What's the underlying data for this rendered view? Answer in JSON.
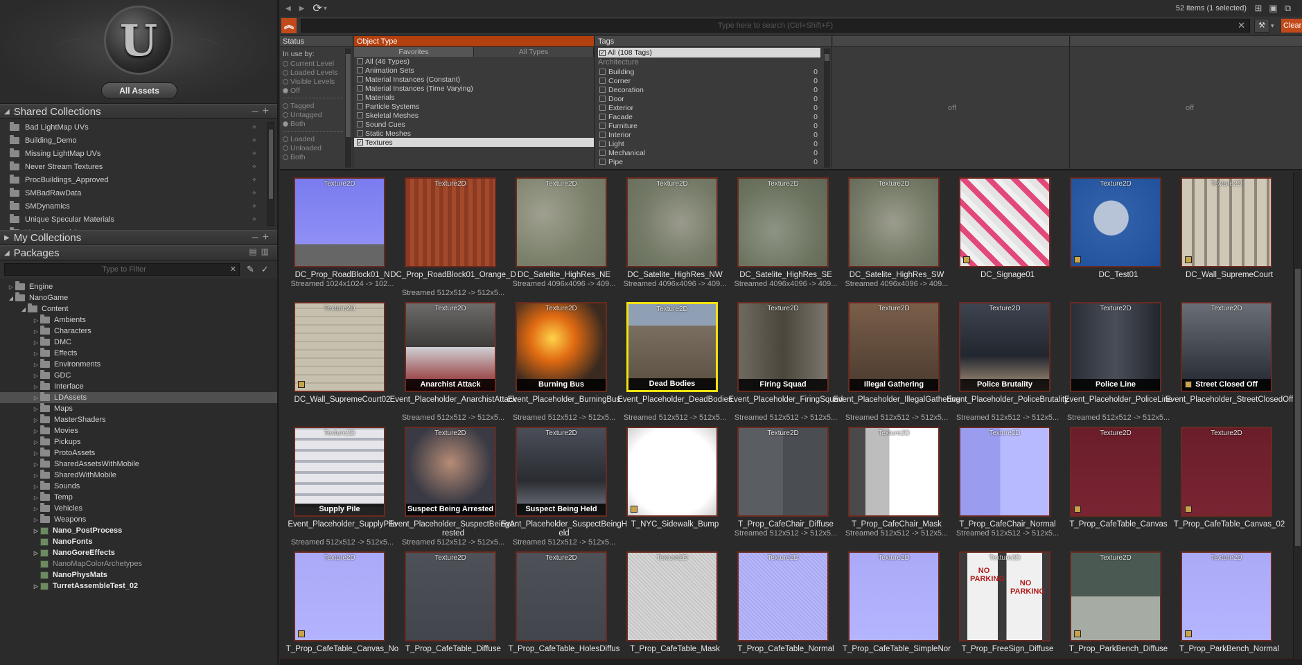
{
  "left": {
    "all_assets_label": "All Assets",
    "shared_collections": {
      "title": "Shared Collections",
      "items": [
        "Bad LightMap UVs",
        "Building_Demo",
        "Missing LightMap UVs",
        "Never Stream Textures",
        "ProcBuildings_Approved",
        "SMBadRawData",
        "SMDynamics",
        "Unique Specular Materials",
        "Unreferenced Assets"
      ]
    },
    "my_collections_title": "My Collections",
    "packages": {
      "title": "Packages",
      "filter_placeholder": "Type to Filter",
      "tree": [
        {
          "label": "Engine",
          "depth": 0,
          "kind": "folder",
          "exp": "▷"
        },
        {
          "label": "NanoGame",
          "depth": 0,
          "kind": "folder",
          "exp": "◢"
        },
        {
          "label": "Content",
          "depth": 1,
          "kind": "folder",
          "exp": "◢"
        },
        {
          "label": "Ambients",
          "depth": 2,
          "kind": "folder",
          "exp": "▷"
        },
        {
          "label": "Characters",
          "depth": 2,
          "kind": "folder",
          "exp": "▷"
        },
        {
          "label": "DMC",
          "depth": 2,
          "kind": "folder",
          "exp": "▷"
        },
        {
          "label": "Effects",
          "depth": 2,
          "kind": "folder",
          "exp": "▷"
        },
        {
          "label": "Environments",
          "depth": 2,
          "kind": "folder",
          "exp": "▷"
        },
        {
          "label": "GDC",
          "depth": 2,
          "kind": "folder",
          "exp": "▷"
        },
        {
          "label": "Interface",
          "depth": 2,
          "kind": "folder",
          "exp": "▷"
        },
        {
          "label": "LDAssets",
          "depth": 2,
          "kind": "folder",
          "exp": "▷",
          "selected": true
        },
        {
          "label": "Maps",
          "depth": 2,
          "kind": "folder",
          "exp": "▷"
        },
        {
          "label": "MasterShaders",
          "depth": 2,
          "kind": "folder",
          "exp": "▷"
        },
        {
          "label": "Movies",
          "depth": 2,
          "kind": "folder",
          "exp": "▷"
        },
        {
          "label": "Pickups",
          "depth": 2,
          "kind": "folder",
          "exp": "▷"
        },
        {
          "label": "ProtoAssets",
          "depth": 2,
          "kind": "folder",
          "exp": "▷"
        },
        {
          "label": "SharedAssetsWithMobile",
          "depth": 2,
          "kind": "folder",
          "exp": "▷"
        },
        {
          "label": "SharedWithMobile",
          "depth": 2,
          "kind": "folder",
          "exp": "▷"
        },
        {
          "label": "Sounds",
          "depth": 2,
          "kind": "folder",
          "exp": "▷"
        },
        {
          "label": "Temp",
          "depth": 2,
          "kind": "folder",
          "exp": "▷"
        },
        {
          "label": "Vehicles",
          "depth": 2,
          "kind": "folder",
          "exp": "▷"
        },
        {
          "label": "Weapons",
          "depth": 2,
          "kind": "folder",
          "exp": "▷"
        },
        {
          "label": "Nano_PostProcess",
          "depth": 2,
          "kind": "pkg",
          "exp": "▷",
          "bold": true
        },
        {
          "label": "NanoFonts",
          "depth": 2,
          "kind": "pkg",
          "exp": "",
          "bold": true
        },
        {
          "label": "NanoGoreEffects",
          "depth": 2,
          "kind": "pkg",
          "exp": "▷",
          "bold": true
        },
        {
          "label": "NanoMapColorArchetypes",
          "depth": 2,
          "kind": "pkg",
          "exp": "",
          "dim": true
        },
        {
          "label": "NanoPhysMats",
          "depth": 2,
          "kind": "pkg",
          "exp": "",
          "bold": true
        },
        {
          "label": "TurretAssembleTest_02",
          "depth": 2,
          "kind": "pkg",
          "exp": "▷",
          "bold": true
        }
      ]
    }
  },
  "topbar": {
    "count_text": "52 items (1 selected)",
    "search_placeholder": "Type here to search  (Ctrl+Shift+F)",
    "clear_label": "Clear"
  },
  "filters": {
    "status": {
      "title": "Status",
      "in_use_label": "In use by:",
      "group1": [
        {
          "label": "Current Level",
          "on": false
        },
        {
          "label": "Loaded Levels",
          "on": false
        },
        {
          "label": "Visible Levels",
          "on": false
        },
        {
          "label": "Off",
          "on": true
        }
      ],
      "group2": [
        {
          "label": "Tagged",
          "on": false
        },
        {
          "label": "Untagged",
          "on": false
        },
        {
          "label": "Both",
          "on": true
        }
      ],
      "group3": [
        {
          "label": "Loaded",
          "on": false
        },
        {
          "label": "Unloaded",
          "on": false
        },
        {
          "label": "Both",
          "on": false
        }
      ]
    },
    "object_type": {
      "title": "Object Type",
      "tab_favorites": "Favorites",
      "tab_all": "All Types",
      "items": [
        {
          "label": "All (46 Types)",
          "checked": false
        },
        {
          "label": "Animation Sets",
          "checked": false
        },
        {
          "label": "Material Instances (Constant)",
          "checked": false
        },
        {
          "label": "Material Instances (Time Varying)",
          "checked": false
        },
        {
          "label": "Materials",
          "checked": false
        },
        {
          "label": "Particle Systems",
          "checked": false
        },
        {
          "label": "Skeletal Meshes",
          "checked": false
        },
        {
          "label": "Sound Cues",
          "checked": false
        },
        {
          "label": "Static Meshes",
          "checked": false
        },
        {
          "label": "Textures",
          "checked": true
        }
      ]
    },
    "tags": {
      "title": "Tags",
      "all_label": "All (108 Tags)",
      "category": "Architecture",
      "items": [
        {
          "label": "Building",
          "count": "0"
        },
        {
          "label": "Corner",
          "count": "0"
        },
        {
          "label": "Decoration",
          "count": "0"
        },
        {
          "label": "Door",
          "count": "0"
        },
        {
          "label": "Exterior",
          "count": "0"
        },
        {
          "label": "Facade",
          "count": "0"
        },
        {
          "label": "Furniture",
          "count": "0"
        },
        {
          "label": "Interior",
          "count": "0"
        },
        {
          "label": "Light",
          "count": "0"
        },
        {
          "label": "Mechanical",
          "count": "0"
        },
        {
          "label": "Pipe",
          "count": "0"
        }
      ]
    },
    "off_label": "off"
  },
  "assets": [
    {
      "name": "DC_Prop_RoadBlock01_N",
      "info": "Streamed 1024x1024 -> 102...",
      "type": "Texture2D",
      "bg": "linear-gradient(#7a7cf0,#8f8ff5 75%,#666 75%)",
      "corner": false
    },
    {
      "name": "DC_Prop_RoadBlock01_Orange_D",
      "info": "Streamed 512x512 -> 512x5...",
      "type": "Texture2D",
      "bg": "repeating-linear-gradient(90deg,#8c3a22 0 6px,#a34a2c 6px 12px)",
      "corner": false
    },
    {
      "name": "DC_Satelite_HighRes_NE",
      "info": "Streamed 4096x4096 -> 409...",
      "type": "Texture2D",
      "bg": "radial-gradient(circle at 30% 40%,#a0a090,#7a806a 60%,#6f7462)",
      "corner": false
    },
    {
      "name": "DC_Satelite_HighRes_NW",
      "info": "Streamed 4096x4096 -> 409...",
      "type": "Texture2D",
      "bg": "radial-gradient(circle at 60% 50%,#9a9a8c,#737a66 60%,#6a6f5f)",
      "corner": false
    },
    {
      "name": "DC_Satelite_HighRes_SE",
      "info": "Streamed 4096x4096 -> 409...",
      "type": "Texture2D",
      "bg": "radial-gradient(circle at 40% 60%,#8e9484,#6c7460 60%,#5f6655)",
      "corner": false
    },
    {
      "name": "DC_Satelite_HighRes_SW",
      "info": "Streamed 4096x4096 -> 409...",
      "type": "Texture2D",
      "bg": "radial-gradient(circle at 50% 50%,#9c9c8e,#767c68 60%,#666b5a)",
      "corner": false
    },
    {
      "name": "DC_Signage01",
      "info": "",
      "type": "",
      "bg": "repeating-linear-gradient(45deg,#e4e4e4 0 10px,#e2487a 10px 18px,#f0f0f0 18px 26px)",
      "corner": true
    },
    {
      "name": "DC_Test01",
      "info": "",
      "type": "Texture2D",
      "bg": "radial-gradient(circle at 45% 45%,#b7c4d8 0 25%,#2f5fa8 26%,#1e4f9a)",
      "corner": true
    },
    {
      "name": "DC_Wall_SupremeCourt",
      "info": "",
      "type": "Texture2D",
      "bg": "repeating-linear-gradient(90deg,#cfc8b6 0 14px,#8e877a 14px 18px)",
      "corner": true
    },
    {
      "name": "DC_Wall_SupremeCourt02",
      "info": "",
      "type": "Texture2D",
      "bg": "repeating-linear-gradient(0deg,#c7c0ae 0 10px,#b4ad9b 10px 12px)",
      "corner": true
    },
    {
      "name": "Event_Placeholder_AnarchistAttack",
      "info": "Streamed 512x512 -> 512x5...",
      "type": "Texture2D",
      "bg": "linear-gradient(#6d6a6a,#3d3a3a 50%,#cfcfd4 50%,#8a1a1a)",
      "caption": "Anarchist Attack",
      "corner": false
    },
    {
      "name": "Event_Placeholder_BurningBus",
      "info": "Streamed 512x512 -> 512x5...",
      "type": "Texture2D",
      "bg": "radial-gradient(circle at 40% 40%,#ffd24a,#e06a12 30%,#3a2a20 70%)",
      "caption": "Burning Bus",
      "corner": false
    },
    {
      "name": "Event_Placeholder_DeadBodies",
      "info": "Streamed 512x512 -> 512x5...",
      "type": "Texture2D",
      "bg": "linear-gradient(#8fa0b4 0 25%,#7a6e60 25%,#5a4e40)",
      "caption": "Dead Bodies",
      "selected": true,
      "corner": false
    },
    {
      "name": "Event_Placeholder_FiringSquad",
      "info": "Streamed 512x512 -> 512x5...",
      "type": "Texture2D",
      "bg": "linear-gradient(90deg,#6e6a60,#4a463c,#7a766c)",
      "caption": "Firing Squad",
      "corner": false
    },
    {
      "name": "Event_Placeholder_IllegalGathering",
      "info": "Streamed 512x512 -> 512x5...",
      "type": "Texture2D",
      "bg": "linear-gradient(#7a5e4a,#4a3a2e)",
      "caption": "Illegal Gathering",
      "corner": false
    },
    {
      "name": "Event_Placeholder_PoliceBrutality",
      "info": "Streamed 512x512 -> 512x5...",
      "type": "Texture2D",
      "bg": "linear-gradient(#3e4450,#22262e 60%,#b09a80)",
      "caption": "Police Brutality",
      "corner": false
    },
    {
      "name": "Event_Placeholder_PoliceLine",
      "info": "Streamed 512x512 -> 512x5...",
      "type": "Texture2D",
      "bg": "linear-gradient(90deg,#2a2e36,#4a4e58,#22262c)",
      "caption": "Police Line",
      "corner": false
    },
    {
      "name": "Event_Placeholder_StreetClosedOff",
      "info": "",
      "type": "Texture2D",
      "bg": "linear-gradient(#6a6e76,#22262e)",
      "caption": "Street Closed Off",
      "corner": true
    },
    {
      "name": "Event_Placeholder_SupplyPile",
      "info": "Streamed 512x512 -> 512x5...",
      "type": "Texture2D",
      "bg": "repeating-linear-gradient(0deg,#e6e6ea 0 12px,#aeb2bc 12px 16px)",
      "caption": "Supply Pile",
      "corner": false
    },
    {
      "name": "Event_Placeholder_SuspectBeingArrested",
      "info": "Streamed 512x512 -> 512x5...",
      "type": "Texture2D",
      "bg": "radial-gradient(circle at 50% 40%,#b68c76,#3a3a44 60%)",
      "caption": "Suspect Being Arrested",
      "corner": false
    },
    {
      "name": "Event_Placeholder_SuspectBeingHeld",
      "info": "Streamed 512x512 -> 512x5...",
      "type": "Texture2D",
      "bg": "linear-gradient(#4a4e58,#2a2c32 60%,#7a7e88)",
      "caption": "Suspect Being Held",
      "corner": false
    },
    {
      "name": "T_NYC_Sidewalk_Bump",
      "info": "",
      "type": "",
      "bg": "radial-gradient(#ffffff 70%,#cfcfcf)",
      "corner": true
    },
    {
      "name": "T_Prop_CafeChair_Diffuse",
      "info": "Streamed 512x512 -> 512x5...",
      "type": "Texture2D",
      "bg": "linear-gradient(90deg,#5a5d62 0 50%,#4a4d52 50%)",
      "corner": false
    },
    {
      "name": "T_Prop_CafeChair_Mask",
      "info": "Streamed 512x512 -> 512x5...",
      "type": "Texture2D",
      "bg": "linear-gradient(90deg,#4a4a4a 0 18%,#bdbdbd 18% 45%,#ffffff 45%)",
      "corner": false
    },
    {
      "name": "T_Prop_CafeChair_Normal",
      "info": "Streamed 512x512 -> 512x5...",
      "type": "Texture2D",
      "bg": "linear-gradient(90deg,#9a9cf0 0 45%,#b8baff 45%)",
      "corner": false
    },
    {
      "name": "T_Prop_CafeTable_Canvas",
      "info": "",
      "type": "Texture2D",
      "bg": "linear-gradient(#6a1e2a,#7a2432)",
      "corner": true
    },
    {
      "name": "T_Prop_CafeTable_Canvas_02",
      "info": "",
      "type": "Texture2D",
      "bg": "linear-gradient(#6a1e2a,#7a2432)",
      "corner": true
    },
    {
      "name": "T_Prop_CafeTable_Canvas_No",
      "info": "",
      "type": "Texture2D",
      "bg": "linear-gradient(#aaaaf8,#b2b2ff)",
      "corner": true
    },
    {
      "name": "T_Prop_CafeTable_Diffuse",
      "info": "",
      "type": "Texture2D",
      "bg": "linear-gradient(#4e5258,#42464c)",
      "corner": false
    },
    {
      "name": "T_Prop_CafeTable_HolesDiffus",
      "info": "",
      "type": "Texture2D",
      "bg": "linear-gradient(#4e5258,#42464c)",
      "corner": false
    },
    {
      "name": "T_Prop_CafeTable_Mask",
      "info": "",
      "type": "Texture2D",
      "bg": "repeating-linear-gradient(45deg,#c4c4c4 0 2px,#d8d8d8 2px 4px)",
      "corner": false
    },
    {
      "name": "T_Prop_CafeTable_Normal",
      "info": "",
      "type": "Texture2D",
      "bg": "repeating-linear-gradient(45deg,#a8a8f2 0 2px,#b8b8fa 2px 4px)",
      "corner": false
    },
    {
      "name": "T_Prop_CafeTable_SimpleNor",
      "info": "",
      "type": "Texture2D",
      "bg": "linear-gradient(#aaaaf8,#b4b4ff)",
      "corner": false
    },
    {
      "name": "T_Prop_FreeSign_Diffuse",
      "info": "",
      "type": "Texture2D",
      "bg": "linear-gradient(90deg,#3a3a3a 0 8%,#f0f0f0 8% 42%,#3a3a3a 42% 52%,#f0f0f0 52% 92%,#3a3a3a 92%)",
      "sign1": "NO PARKING",
      "sign2": "NO PARKING",
      "corner": false
    },
    {
      "name": "T_Prop_ParkBench_Diffuse",
      "info": "",
      "type": "Texture2D",
      "bg": "linear-gradient(#4a5a52 0 50%,#a6aca4 50%)",
      "corner": true
    },
    {
      "name": "T_Prop_ParkBench_Normal",
      "info": "",
      "type": "Texture2D",
      "bg": "linear-gradient(#aaaaf8,#b4b4ff)",
      "corner": true
    }
  ]
}
